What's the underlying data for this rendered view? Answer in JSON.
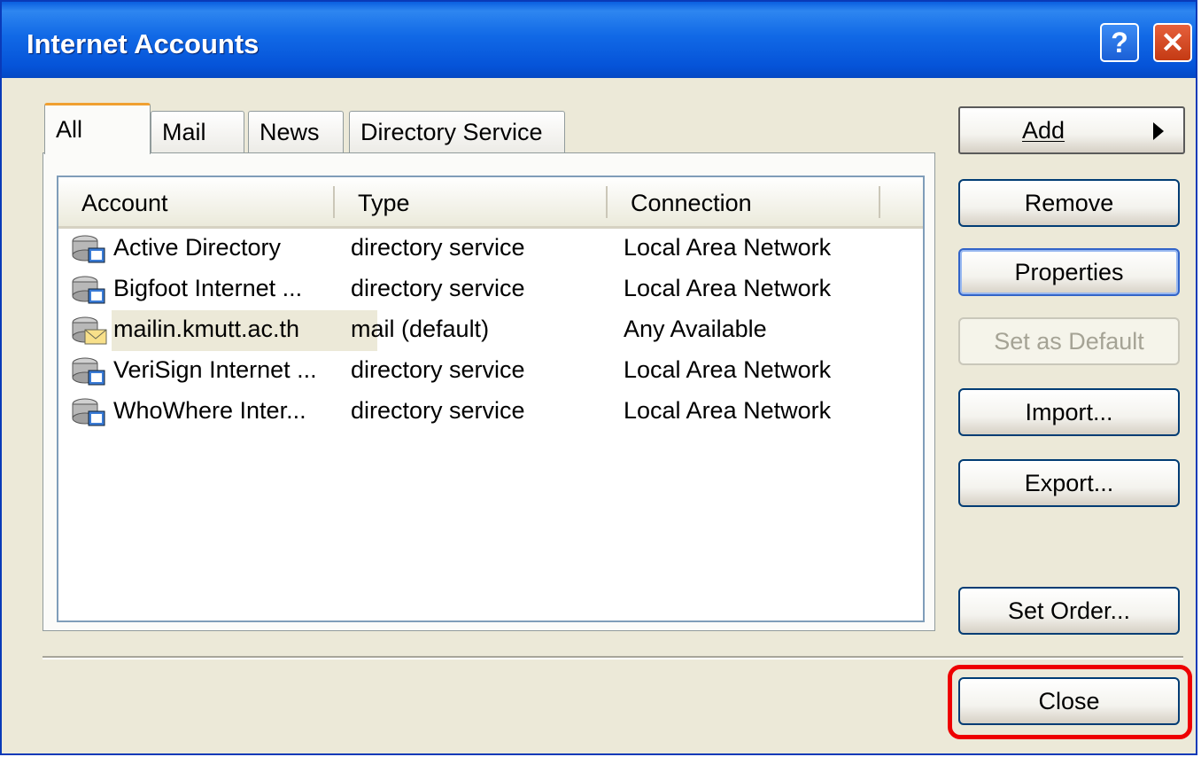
{
  "window": {
    "title": "Internet Accounts",
    "help_glyph": "?",
    "close_glyph": "✕"
  },
  "tabs": [
    {
      "label": "All",
      "active": true
    },
    {
      "label": "Mail",
      "active": false
    },
    {
      "label": "News",
      "active": false
    },
    {
      "label": "Directory Service",
      "active": false
    }
  ],
  "list": {
    "columns": [
      "Account",
      "Type",
      "Connection"
    ],
    "rows": [
      {
        "account": "Active Directory",
        "type": "directory service",
        "connection": "Local Area Network",
        "icon": "directory-service-icon"
      },
      {
        "account": "Bigfoot Internet ...",
        "type": "directory service",
        "connection": "Local Area Network",
        "icon": "directory-service-icon"
      },
      {
        "account": "mailin.kmutt.ac.th",
        "type": "mail (default)",
        "connection": "Any Available",
        "icon": "mail-account-icon",
        "selected": true
      },
      {
        "account": "VeriSign Internet ...",
        "type": "directory service",
        "connection": "Local Area Network",
        "icon": "directory-service-icon"
      },
      {
        "account": "WhoWhere Inter...",
        "type": "directory service",
        "connection": "Local Area Network",
        "icon": "directory-service-icon"
      }
    ]
  },
  "buttons": {
    "add": "Add",
    "remove": "Remove",
    "properties": "Properties",
    "set_default": "Set as Default",
    "import": "Import...",
    "export": "Export...",
    "set_order": "Set Order...",
    "close": "Close"
  },
  "colors": {
    "highlight": "#ee0000",
    "titlebar": "#0a5fe0",
    "dialog_bg": "#ece9d8"
  }
}
